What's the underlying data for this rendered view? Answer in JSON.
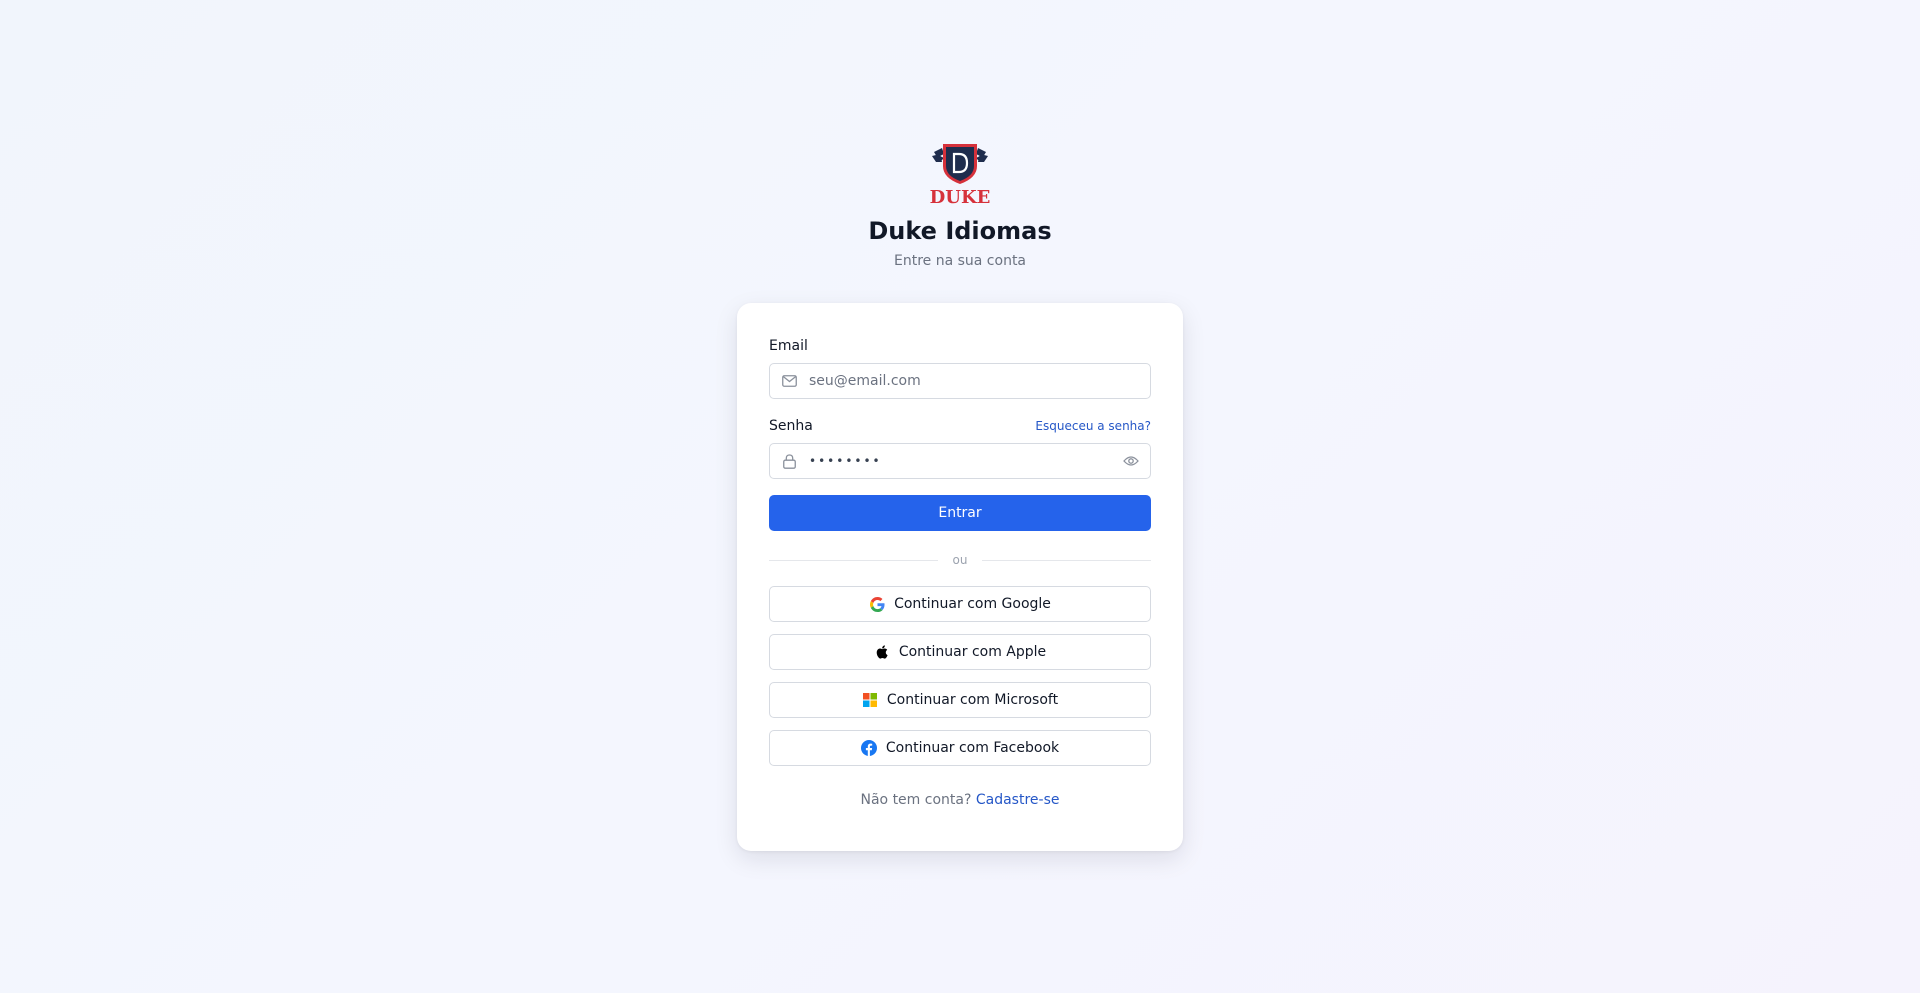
{
  "brand": {
    "logo_text": "DUKE",
    "title": "Duke Idiomas",
    "subtitle": "Entre na sua conta",
    "colors": {
      "logo_navy": "#1f2d4d",
      "logo_red": "#d6313b"
    }
  },
  "form": {
    "email_label": "Email",
    "email_placeholder": "seu@email.com",
    "email_value": "",
    "email_icon": "mail-icon",
    "password_label": "Senha",
    "forgot_link": "Esqueceu a senha?",
    "password_value": "••••••••",
    "password_icon": "lock-icon",
    "toggle_visibility_icon": "eye-icon",
    "submit_label": "Entrar",
    "divider_text": "ou"
  },
  "social": [
    {
      "label": "Continuar com Google",
      "icon": "google-icon"
    },
    {
      "label": "Continuar com Apple",
      "icon": "apple-icon"
    },
    {
      "label": "Continuar com Microsoft",
      "icon": "microsoft-icon"
    },
    {
      "label": "Continuar com Facebook",
      "icon": "facebook-icon"
    }
  ],
  "footer": {
    "prompt": "Não tem conta?",
    "signup_link": "Cadastre-se"
  },
  "colors": {
    "primary": "#2563eb",
    "link": "#2557c7",
    "facebook": "#1877f2"
  }
}
